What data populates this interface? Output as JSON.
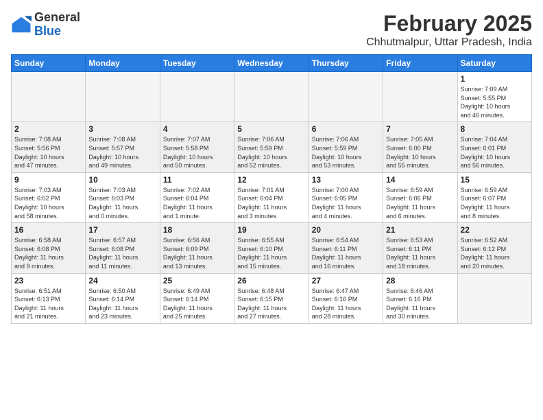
{
  "header": {
    "logo_general": "General",
    "logo_blue": "Blue",
    "month_title": "February 2025",
    "location": "Chhutmalpur, Uttar Pradesh, India"
  },
  "weekdays": [
    "Sunday",
    "Monday",
    "Tuesday",
    "Wednesday",
    "Thursday",
    "Friday",
    "Saturday"
  ],
  "weeks": [
    {
      "shaded": false,
      "days": [
        {
          "num": "",
          "info": ""
        },
        {
          "num": "",
          "info": ""
        },
        {
          "num": "",
          "info": ""
        },
        {
          "num": "",
          "info": ""
        },
        {
          "num": "",
          "info": ""
        },
        {
          "num": "",
          "info": ""
        },
        {
          "num": "1",
          "info": "Sunrise: 7:09 AM\nSunset: 5:55 PM\nDaylight: 10 hours\nand 46 minutes."
        }
      ]
    },
    {
      "shaded": true,
      "days": [
        {
          "num": "2",
          "info": "Sunrise: 7:08 AM\nSunset: 5:56 PM\nDaylight: 10 hours\nand 47 minutes."
        },
        {
          "num": "3",
          "info": "Sunrise: 7:08 AM\nSunset: 5:57 PM\nDaylight: 10 hours\nand 49 minutes."
        },
        {
          "num": "4",
          "info": "Sunrise: 7:07 AM\nSunset: 5:58 PM\nDaylight: 10 hours\nand 50 minutes."
        },
        {
          "num": "5",
          "info": "Sunrise: 7:06 AM\nSunset: 5:59 PM\nDaylight: 10 hours\nand 52 minutes."
        },
        {
          "num": "6",
          "info": "Sunrise: 7:06 AM\nSunset: 5:59 PM\nDaylight: 10 hours\nand 53 minutes."
        },
        {
          "num": "7",
          "info": "Sunrise: 7:05 AM\nSunset: 6:00 PM\nDaylight: 10 hours\nand 55 minutes."
        },
        {
          "num": "8",
          "info": "Sunrise: 7:04 AM\nSunset: 6:01 PM\nDaylight: 10 hours\nand 56 minutes."
        }
      ]
    },
    {
      "shaded": false,
      "days": [
        {
          "num": "9",
          "info": "Sunrise: 7:03 AM\nSunset: 6:02 PM\nDaylight: 10 hours\nand 58 minutes."
        },
        {
          "num": "10",
          "info": "Sunrise: 7:03 AM\nSunset: 6:03 PM\nDaylight: 11 hours\nand 0 minutes."
        },
        {
          "num": "11",
          "info": "Sunrise: 7:02 AM\nSunset: 6:04 PM\nDaylight: 11 hours\nand 1 minute."
        },
        {
          "num": "12",
          "info": "Sunrise: 7:01 AM\nSunset: 6:04 PM\nDaylight: 11 hours\nand 3 minutes."
        },
        {
          "num": "13",
          "info": "Sunrise: 7:00 AM\nSunset: 6:05 PM\nDaylight: 11 hours\nand 4 minutes."
        },
        {
          "num": "14",
          "info": "Sunrise: 6:59 AM\nSunset: 6:06 PM\nDaylight: 11 hours\nand 6 minutes."
        },
        {
          "num": "15",
          "info": "Sunrise: 6:59 AM\nSunset: 6:07 PM\nDaylight: 11 hours\nand 8 minutes."
        }
      ]
    },
    {
      "shaded": true,
      "days": [
        {
          "num": "16",
          "info": "Sunrise: 6:58 AM\nSunset: 6:08 PM\nDaylight: 11 hours\nand 9 minutes."
        },
        {
          "num": "17",
          "info": "Sunrise: 6:57 AM\nSunset: 6:08 PM\nDaylight: 11 hours\nand 11 minutes."
        },
        {
          "num": "18",
          "info": "Sunrise: 6:56 AM\nSunset: 6:09 PM\nDaylight: 11 hours\nand 13 minutes."
        },
        {
          "num": "19",
          "info": "Sunrise: 6:55 AM\nSunset: 6:10 PM\nDaylight: 11 hours\nand 15 minutes."
        },
        {
          "num": "20",
          "info": "Sunrise: 6:54 AM\nSunset: 6:11 PM\nDaylight: 11 hours\nand 16 minutes."
        },
        {
          "num": "21",
          "info": "Sunrise: 6:53 AM\nSunset: 6:11 PM\nDaylight: 11 hours\nand 18 minutes."
        },
        {
          "num": "22",
          "info": "Sunrise: 6:52 AM\nSunset: 6:12 PM\nDaylight: 11 hours\nand 20 minutes."
        }
      ]
    },
    {
      "shaded": false,
      "days": [
        {
          "num": "23",
          "info": "Sunrise: 6:51 AM\nSunset: 6:13 PM\nDaylight: 11 hours\nand 21 minutes."
        },
        {
          "num": "24",
          "info": "Sunrise: 6:50 AM\nSunset: 6:14 PM\nDaylight: 11 hours\nand 23 minutes."
        },
        {
          "num": "25",
          "info": "Sunrise: 6:49 AM\nSunset: 6:14 PM\nDaylight: 11 hours\nand 25 minutes."
        },
        {
          "num": "26",
          "info": "Sunrise: 6:48 AM\nSunset: 6:15 PM\nDaylight: 11 hours\nand 27 minutes."
        },
        {
          "num": "27",
          "info": "Sunrise: 6:47 AM\nSunset: 6:16 PM\nDaylight: 11 hours\nand 28 minutes."
        },
        {
          "num": "28",
          "info": "Sunrise: 6:46 AM\nSunset: 6:16 PM\nDaylight: 11 hours\nand 30 minutes."
        },
        {
          "num": "",
          "info": ""
        }
      ]
    }
  ]
}
